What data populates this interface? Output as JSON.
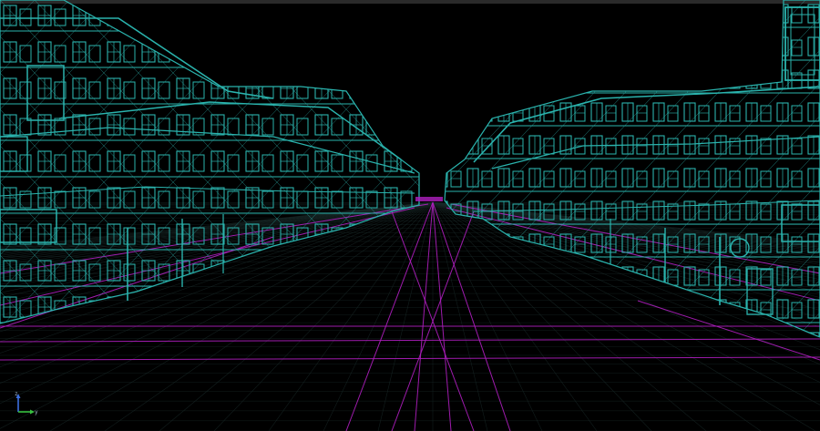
{
  "viewport": {
    "mode": "wireframe-perspective",
    "colors": {
      "background": "#000000",
      "top_bar": "#2a2a2a",
      "building_wire": "#2ab3ad",
      "guide_lines": "#b01fc0",
      "grid_minor": "#1a2b2a",
      "axis_z": "#3c6fe0",
      "axis_y": "#38c040"
    }
  },
  "axis_gizmo": {
    "z_label": "z",
    "y_label": "y",
    "z_icon": "axis-z-arrow-icon",
    "y_icon": "axis-y-arrow-icon"
  }
}
